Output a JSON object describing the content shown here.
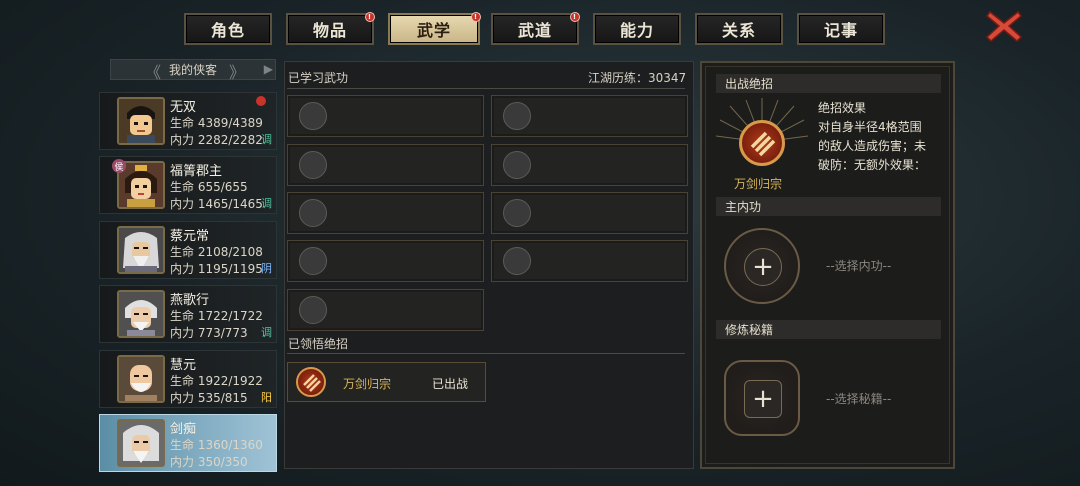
{
  "tabs": [
    {
      "label": "角色",
      "active": false,
      "alert": false
    },
    {
      "label": "物品",
      "active": false,
      "alert": true
    },
    {
      "label": "武学",
      "active": true,
      "alert": true
    },
    {
      "label": "武道",
      "active": false,
      "alert": true
    },
    {
      "label": "能力",
      "active": false,
      "alert": false
    },
    {
      "label": "关系",
      "active": false,
      "alert": false
    },
    {
      "label": "记事",
      "active": false,
      "alert": false
    }
  ],
  "party": {
    "header": "我的侠客",
    "members": [
      {
        "name": "无双",
        "hp": "生命 4389/4389",
        "mp": "内力 2282/2282",
        "tag": "调",
        "tag_color": "#4fc8a0",
        "alert": true,
        "badge": ""
      },
      {
        "name": "福箐郡主",
        "hp": "生命 655/655",
        "mp": "内力 1465/1465",
        "tag": "调",
        "tag_color": "#4fc8a0",
        "alert": false,
        "badge": "侯"
      },
      {
        "name": "蔡元常",
        "hp": "生命 2108/2108",
        "mp": "内力 1195/1195",
        "tag": "阴",
        "tag_color": "#7fb8ff",
        "alert": false,
        "badge": ""
      },
      {
        "name": "燕歌行",
        "hp": "生命 1722/1722",
        "mp": "内力 773/773",
        "tag": "调",
        "tag_color": "#4fc8a0",
        "alert": false,
        "badge": ""
      },
      {
        "name": "慧元",
        "hp": "生命 1922/1922",
        "mp": "内力 535/815",
        "tag": "阳",
        "tag_color": "#ffd24a",
        "alert": false,
        "badge": ""
      },
      {
        "name": "剑痴",
        "hp": "生命 1360/1360",
        "mp": "内力 350/350",
        "tag": "",
        "tag_color": "",
        "alert": false,
        "badge": "",
        "active": true
      }
    ]
  },
  "skills": {
    "learned_label": "已学习武功",
    "experience": "江湖历练：30347",
    "comprehended_label": "已领悟绝招",
    "technique": {
      "name": "万剑归宗",
      "status": "已出战"
    }
  },
  "right": {
    "battle_header": "出战绝招",
    "effect_title": "绝招效果",
    "effect_text": "对自身半径4格范围的敌人造成伤害；未破防：无额外效果：",
    "technique_name": "万剑归宗",
    "internal_header": "主内功",
    "internal_hint": "--选择内功--",
    "manual_header": "修炼秘籍",
    "manual_hint": "--选择秘籍--",
    "plus": "+"
  },
  "colors": {
    "accent": "#d8b55a",
    "alert": "#c8332a",
    "active_member": "#7fb0c8"
  }
}
